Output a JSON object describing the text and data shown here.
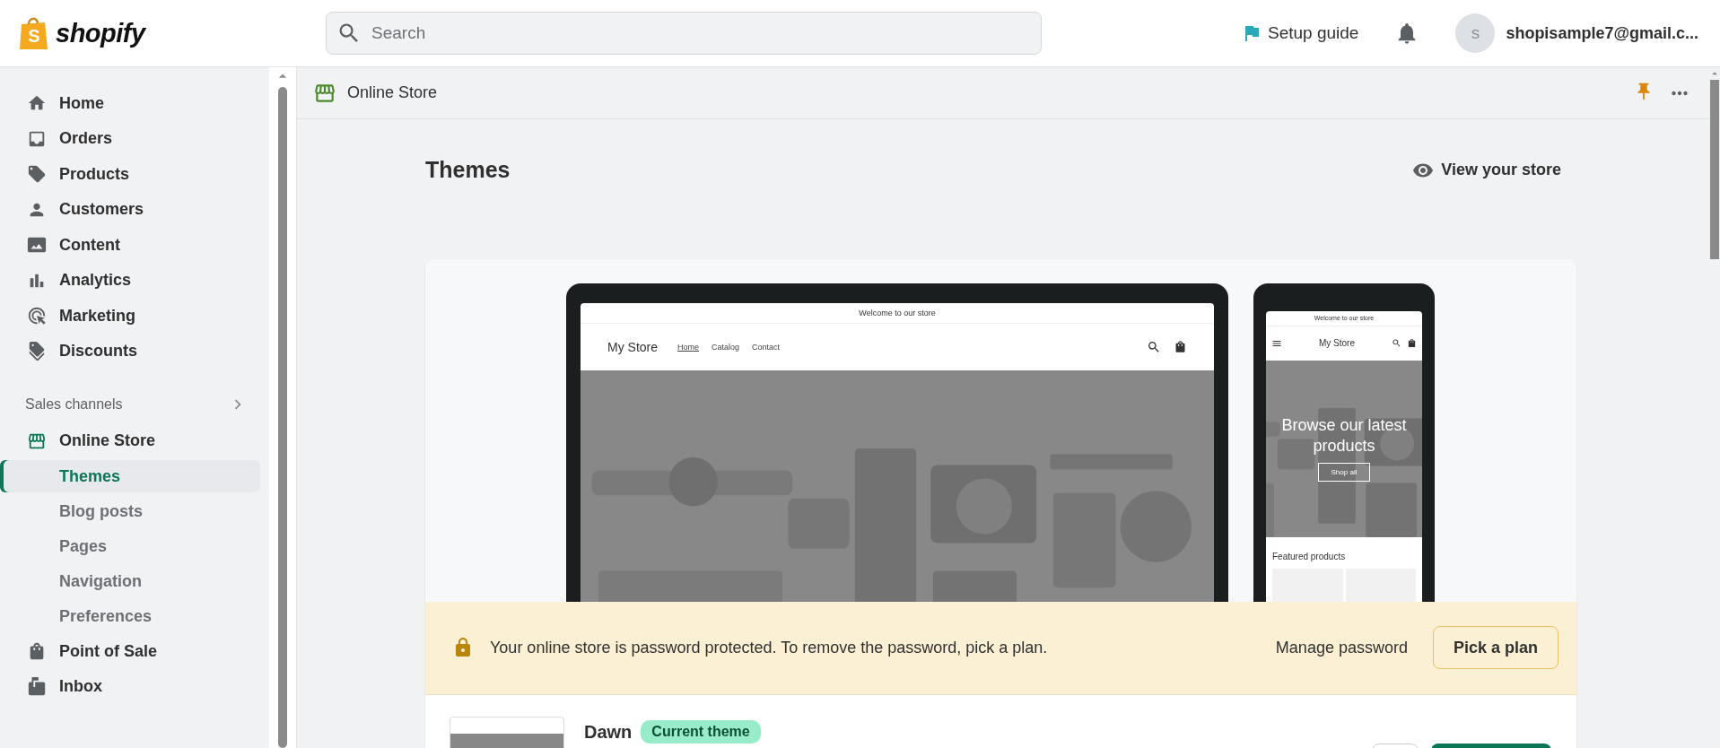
{
  "topbar": {
    "logo": {
      "mark": "S",
      "wordmark": "shopify"
    },
    "search": {
      "placeholder": "Search"
    },
    "setup_guide": "Setup guide",
    "avatar": "s",
    "account": "shopisample7@gmail.c..."
  },
  "sidebar": {
    "items": [
      {
        "label": "Home",
        "selected": false
      },
      {
        "label": "Orders",
        "selected": false
      },
      {
        "label": "Products",
        "selected": false
      },
      {
        "label": "Customers",
        "selected": false
      },
      {
        "label": "Content",
        "selected": false
      },
      {
        "label": "Analytics",
        "selected": false
      },
      {
        "label": "Marketing",
        "selected": false
      },
      {
        "label": "Discounts",
        "selected": false
      }
    ],
    "sales_channels": {
      "title": "Sales channels",
      "items": [
        {
          "label": "Online Store",
          "selected": false,
          "children": [
            {
              "label": "Themes",
              "selected": true
            },
            {
              "label": "Blog posts",
              "selected": false
            },
            {
              "label": "Pages",
              "selected": false
            },
            {
              "label": "Navigation",
              "selected": false
            },
            {
              "label": "Preferences",
              "selected": false
            }
          ]
        },
        {
          "label": "Point of Sale",
          "selected": false
        },
        {
          "label": "Inbox",
          "selected": false
        }
      ]
    }
  },
  "header": {
    "title": "Online Store"
  },
  "page": {
    "title": "Themes",
    "view_store": "View your store"
  },
  "preview": {
    "desktop": {
      "announcement": "Welcome to our store",
      "store_name": "My Store",
      "nav": [
        {
          "label": "Home",
          "selected": true
        },
        {
          "label": "Catalog",
          "selected": false
        },
        {
          "label": "Contact",
          "selected": false
        }
      ]
    },
    "mobile": {
      "announcement": "Welcome to our store",
      "store_name": "My Store",
      "hero_title": "Browse our latest products",
      "hero_button": "Shop all",
      "section_title": "Featured products"
    }
  },
  "banner": {
    "message": "Your online store is password protected. To remove the password, pick a plan.",
    "link": "Manage password",
    "button": "Pick a plan"
  },
  "theme": {
    "name": "Dawn",
    "badge": "Current theme"
  }
}
